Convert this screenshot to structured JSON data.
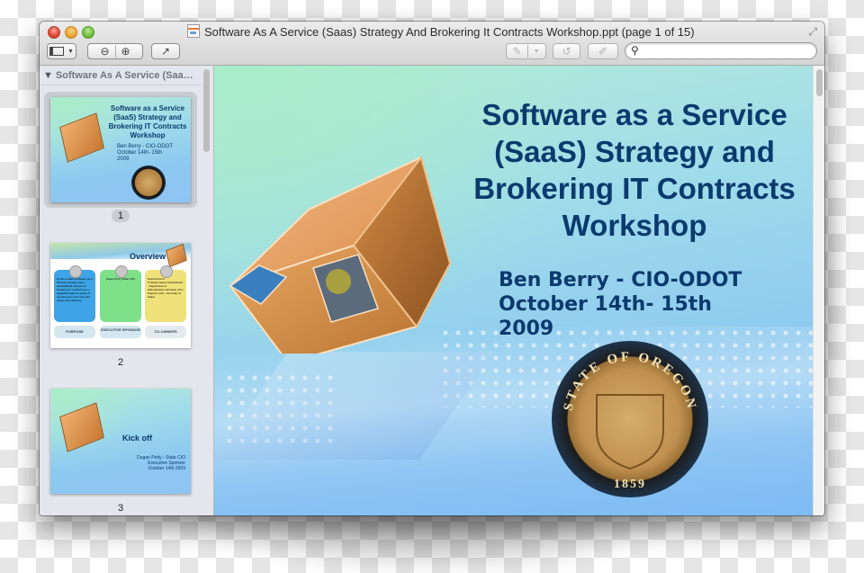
{
  "window": {
    "title": "Software As A Service (Saas) Strategy And Brokering It Contracts Workshop.ppt (page 1 of 15)",
    "doc_icon": "powerpoint-document-icon",
    "controls": [
      "close",
      "minimize",
      "zoom"
    ]
  },
  "toolbar": {
    "sidebar_toggle_icon": "sidebar-view-icon",
    "zoom_out_icon": "zoom-out-icon",
    "zoom_in_icon": "zoom-in-icon",
    "share_icon": "share-icon",
    "annotate_icon": "pen-annotate-icon",
    "rotate_icon": "rotate-icon",
    "edit_icon": "edit-icon",
    "search_placeholder": "",
    "search_value": ""
  },
  "sidebar": {
    "header": "Software As A Service (Saa…",
    "pages": [
      {
        "number": "1",
        "selected": true,
        "title": "Software as a Service (SaaS) Strategy and Brokering IT Contracts Workshop",
        "lines": [
          "Ben Berry - CIO-ODOT",
          "October 14th- 15th",
          "2009"
        ]
      },
      {
        "number": "2",
        "selected": false,
        "title": "Overview",
        "cards": [
          {
            "body": "Derive a SaaS (Software as a Service) strategy and a standardized process for brokering IT contracts on a statewide basis to reduce IT procurement cycle time and obtain cost efficiency",
            "label": "PURPOSE",
            "color": "#3ea4e6"
          },
          {
            "body": "Dugan Petty (State CIO)",
            "label": "EXECUTIVE SPONSOR",
            "color": "#7fe08a"
          },
          {
            "body": "David Almond (Transformation Administrator - Department of Administrative Services) John Pearson (CIO - Secretary of State)",
            "label": "CO-OWNERS",
            "color": "#f0e27a"
          }
        ]
      },
      {
        "number": "3",
        "selected": false,
        "title": "Kick off",
        "lines": [
          "Dugan Petty - State CIO",
          "Executive Sponsor",
          "October 14th 2009"
        ]
      }
    ]
  },
  "slide": {
    "title_lines": [
      "Software as a Service",
      "(SaaS) Strategy and",
      "Brokering IT Contracts",
      "Workshop"
    ],
    "subtitle_lines": [
      "Ben Berry - CIO-ODOT",
      "October 14th- 15th",
      "2009"
    ],
    "seal": {
      "top_text": "STATE OF OREGON",
      "year": "1859"
    },
    "title_color": "#0b3a6e"
  }
}
